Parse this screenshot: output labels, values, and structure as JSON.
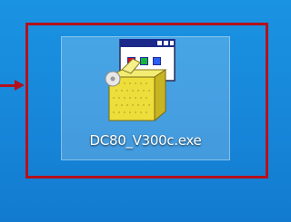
{
  "desktop": {
    "file": {
      "name": "DC80_V300c.exe",
      "icon": "installer-exe-icon"
    }
  },
  "annotation": {
    "color": "#b4111c"
  }
}
